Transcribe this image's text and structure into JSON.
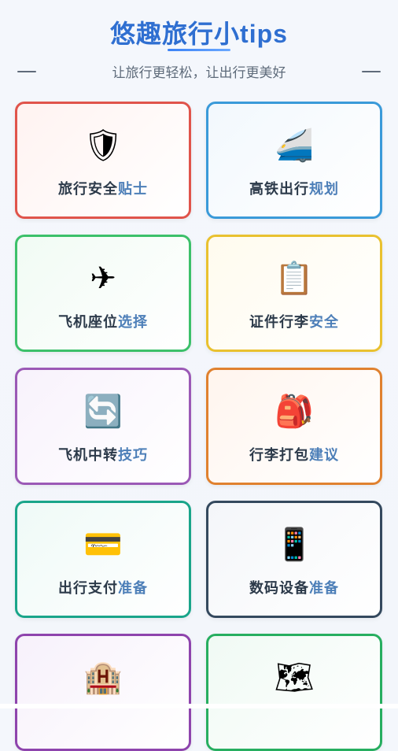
{
  "header": {
    "title": "悠趣旅行小tips",
    "subtitle": "让旅行更轻松，让出行更美好"
  },
  "cards": [
    {
      "label_a": "旅行安全",
      "label_b": "贴士",
      "icon": "🛡",
      "icon_name": "shield-icon",
      "border": "#e0544b",
      "bg": "#fff3f1"
    },
    {
      "label_a": "高铁出行",
      "label_b": "规划",
      "icon": "🚄",
      "icon_name": "bullet-train-icon",
      "border": "#3a9ad9",
      "bg": "#f2f8fd"
    },
    {
      "label_a": "飞机座位",
      "label_b": "选择",
      "icon": "✈",
      "icon_name": "airplane-icon",
      "border": "#3cc06a",
      "bg": "#f1fbf4"
    },
    {
      "label_a": "证件行李",
      "label_b": "安全",
      "icon": "📋",
      "icon_name": "clipboard-icon",
      "border": "#e9c12f",
      "bg": "#fffbee"
    },
    {
      "label_a": "飞机中转",
      "label_b": "技巧",
      "icon": "🔄",
      "icon_name": "transfer-arrows-icon",
      "border": "#9b59b6",
      "bg": "#f8f2fc"
    },
    {
      "label_a": "行李打包",
      "label_b": "建议",
      "icon": "🎒",
      "icon_name": "backpack-icon",
      "border": "#e0812f",
      "bg": "#fff5ee"
    },
    {
      "label_a": "出行支付",
      "label_b": "准备",
      "icon": "💳",
      "icon_name": "credit-card-icon",
      "border": "#1aa58a",
      "bg": "#effaf7"
    },
    {
      "label_a": "数码设备",
      "label_b": "准备",
      "icon": "📱",
      "icon_name": "mobile-phone-icon",
      "border": "#34495e",
      "bg": "#f4f6f9"
    },
    {
      "label_a": "",
      "label_b": "",
      "icon": "🏨",
      "icon_name": "hotel-icon",
      "border": "#8e44ad",
      "bg": "#f7f1fb"
    },
    {
      "label_a": "",
      "label_b": "",
      "icon": "🗺",
      "icon_name": "map-icon",
      "border": "#27ae60",
      "bg": "#f0faf4"
    }
  ]
}
